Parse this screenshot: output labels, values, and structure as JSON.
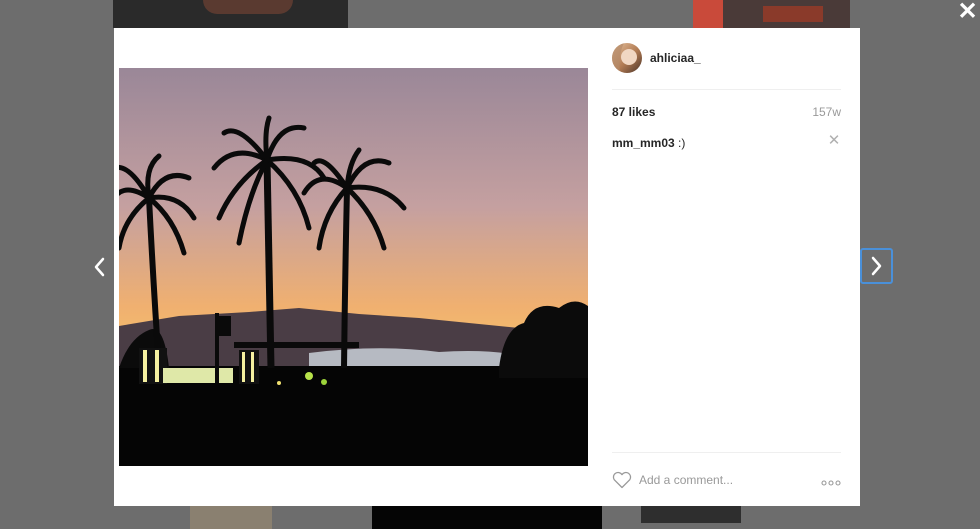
{
  "post": {
    "username": "ahliciaa_",
    "likes": "87 likes",
    "time_ago": "157w",
    "comments": [
      {
        "user": "mm_mm03",
        "text": " :)"
      }
    ]
  },
  "input": {
    "placeholder": "Add a comment..."
  },
  "controls": {
    "close_glyph": "✕",
    "remove_comment_glyph": "✕"
  },
  "icons": {
    "close": "close-icon",
    "prev": "chevron-left-icon",
    "next": "chevron-right-icon",
    "heart": "heart-icon",
    "more": "more-options-icon"
  },
  "colors": {
    "overlay": "#6d6d6d",
    "accent_focus": "#4a90d9",
    "text_primary": "#262626",
    "text_muted": "#999999"
  }
}
